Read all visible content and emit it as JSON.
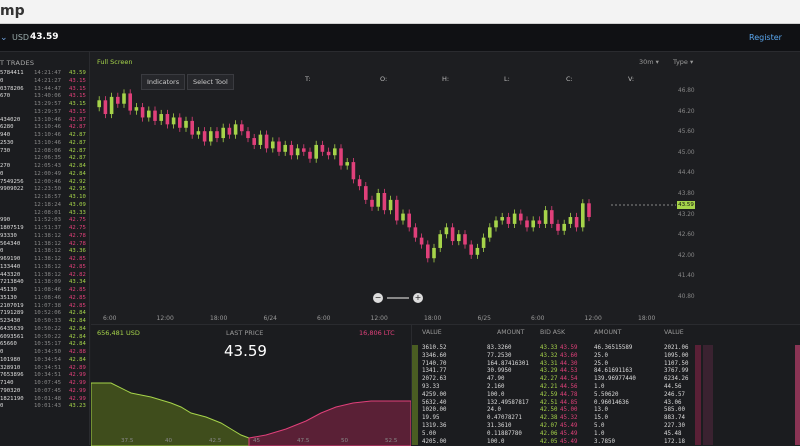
{
  "topbar": {
    "logo": "mp"
  },
  "navbar": {
    "currency": "USD",
    "price": "43.59",
    "register": "Register"
  },
  "trades": {
    "header": "T TRADES",
    "rows": [
      {
        "amount": "5784411",
        "time": "14:21:47",
        "price": "43.59",
        "dir": "up"
      },
      {
        "amount": "0",
        "time": "14:21:27",
        "price": "43.15",
        "dir": "dn"
      },
      {
        "amount": "0378206",
        "time": "13:44:47",
        "price": "43.15",
        "dir": "dn"
      },
      {
        "amount": "670",
        "time": "13:40:06",
        "price": "43.15",
        "dir": "dn"
      },
      {
        "amount": "",
        "time": "13:29:57",
        "price": "43.15",
        "dir": "up"
      },
      {
        "amount": "",
        "time": "13:29:57",
        "price": "43.15",
        "dir": "dn"
      },
      {
        "amount": "434020",
        "time": "13:10:46",
        "price": "42.87",
        "dir": "dn"
      },
      {
        "amount": "6280",
        "time": "13:10:46",
        "price": "42.87",
        "dir": "dn"
      },
      {
        "amount": "940",
        "time": "13:10:46",
        "price": "42.87",
        "dir": "up"
      },
      {
        "amount": "2530",
        "time": "13:10:46",
        "price": "42.87",
        "dir": "up"
      },
      {
        "amount": "730",
        "time": "12:08:06",
        "price": "42.87",
        "dir": "up"
      },
      {
        "amount": "",
        "time": "12:06:35",
        "price": "42.87",
        "dir": "up"
      },
      {
        "amount": "270",
        "time": "12:05:43",
        "price": "42.84",
        "dir": "up"
      },
      {
        "amount": "0",
        "time": "12:00:49",
        "price": "42.84",
        "dir": "up"
      },
      {
        "amount": "7549256",
        "time": "12:00:46",
        "price": "42.92",
        "dir": "up"
      },
      {
        "amount": "9909022",
        "time": "12:23:50",
        "price": "42.95",
        "dir": "up"
      },
      {
        "amount": "",
        "time": "12:18:57",
        "price": "43.10",
        "dir": "up"
      },
      {
        "amount": "",
        "time": "12:18:24",
        "price": "43.09",
        "dir": "up"
      },
      {
        "amount": "",
        "time": "12:08:01",
        "price": "43.33",
        "dir": "up"
      },
      {
        "amount": "990",
        "time": "11:52:03",
        "price": "42.75",
        "dir": "dn"
      },
      {
        "amount": "1807519",
        "time": "11:51:37",
        "price": "42.75",
        "dir": "dn"
      },
      {
        "amount": "93330",
        "time": "11:38:12",
        "price": "42.78",
        "dir": "dn"
      },
      {
        "amount": "564340",
        "time": "11:38:12",
        "price": "42.78",
        "dir": "dn"
      },
      {
        "amount": "0",
        "time": "11:38:12",
        "price": "43.36",
        "dir": "up"
      },
      {
        "amount": "969190",
        "time": "11:38:12",
        "price": "42.85",
        "dir": "dn"
      },
      {
        "amount": "133440",
        "time": "11:38:12",
        "price": "42.85",
        "dir": "dn"
      },
      {
        "amount": "443320",
        "time": "11:38:12",
        "price": "42.82",
        "dir": "dn"
      },
      {
        "amount": "7213840",
        "time": "11:38:09",
        "price": "43.34",
        "dir": "up"
      },
      {
        "amount": "45130",
        "time": "11:08:46",
        "price": "42.85",
        "dir": "dn"
      },
      {
        "amount": "35130",
        "time": "11:08:46",
        "price": "42.85",
        "dir": "dn"
      },
      {
        "amount": "2107019",
        "time": "11:07:38",
        "price": "42.85",
        "dir": "dn"
      },
      {
        "amount": "7191289",
        "time": "10:52:06",
        "price": "42.84",
        "dir": "up"
      },
      {
        "amount": "523430",
        "time": "10:50:33",
        "price": "42.84",
        "dir": "up"
      },
      {
        "amount": "6435639",
        "time": "10:50:22",
        "price": "42.84",
        "dir": "up"
      },
      {
        "amount": "6093561",
        "time": "10:50:22",
        "price": "42.84",
        "dir": "up"
      },
      {
        "amount": "65660",
        "time": "10:35:17",
        "price": "42.84",
        "dir": "up"
      },
      {
        "amount": "0",
        "time": "10:34:50",
        "price": "42.88",
        "dir": "dn"
      },
      {
        "amount": "101980",
        "time": "10:34:54",
        "price": "42.84",
        "dir": "up"
      },
      {
        "amount": "328910",
        "time": "10:34:51",
        "price": "42.89",
        "dir": "dn"
      },
      {
        "amount": "7653896",
        "time": "10:34:51",
        "price": "42.99",
        "dir": "dn"
      },
      {
        "amount": "7140",
        "time": "10:07:45",
        "price": "42.99",
        "dir": "dn"
      },
      {
        "amount": "790320",
        "time": "10:07:45",
        "price": "42.99",
        "dir": "dn"
      },
      {
        "amount": "1821190",
        "time": "10:01:48",
        "price": "42.99",
        "dir": "dn"
      },
      {
        "amount": "0",
        "time": "10:01:43",
        "price": "43.23",
        "dir": "up"
      }
    ]
  },
  "chart": {
    "full_screen": "Full Screen",
    "indicators": "Indicators",
    "select_tool": "Select Tool",
    "ohlc_labels": [
      "T:",
      "O:",
      "H:",
      "L:",
      "C:",
      "V:"
    ],
    "interval": "30m",
    "type_label": "Type",
    "current_price_tag": "43.59",
    "y_ticks": [
      "46.80",
      "46.20",
      "45.60",
      "45.00",
      "44.40",
      "43.80",
      "43.20",
      "42.60",
      "42.00",
      "41.40",
      "40.80"
    ],
    "x_ticks": [
      "6:00",
      "12:00",
      "18:00",
      "6/24",
      "6:00",
      "12:00",
      "18:00",
      "6/25",
      "6:00",
      "12:00",
      "18:00"
    ],
    "zoom_out": "−",
    "zoom_in": "+",
    "up_color": "#a6d44a",
    "down_color": "#e0407a"
  },
  "depth": {
    "buy_total": "656,481 USD",
    "last_price_label": "LAST PRICE",
    "last_price": "43.59",
    "sell_total": "16,806 LTC",
    "x_ticks": [
      "37.5",
      "40",
      "42.5",
      "45",
      "47.5",
      "50",
      "52.5"
    ]
  },
  "book": {
    "headers": [
      "VALUE",
      "AMOUNT",
      "BID ASK",
      "AMOUNT",
      "VALUE"
    ],
    "bid_value": [
      "3610.52",
      "3346.60",
      "7140.70",
      "1341.77",
      "2072.63",
      "93.33",
      "4259.00",
      "5632.40",
      "1020.00",
      "19.95",
      "1319.36",
      "5.00",
      "4205.00"
    ],
    "bid_amount": [
      "83.3260",
      "77.2530",
      "164.87416301",
      "30.9950",
      "47.90",
      "2.160",
      "100.0",
      "132.49587817",
      "24.0",
      "0.47078271",
      "31.3610",
      "0.11887780",
      "100.0"
    ],
    "bid_price": [
      "43.33",
      "43.32",
      "43.31",
      "43.29",
      "42.27",
      "42.21",
      "42.59",
      "42.51",
      "42.50",
      "42.38",
      "42.07",
      "42.06",
      "42.05"
    ],
    "ask_price": [
      "43.59",
      "43.60",
      "44.30",
      "44.53",
      "44.54",
      "44.56",
      "44.78",
      "44.85",
      "45.00",
      "45.32",
      "45.49",
      "45.49",
      "45.49"
    ],
    "ask_amount": [
      "46.36515589",
      "25.0",
      "25.0",
      "84.61691163",
      "139.96977440",
      "1.0",
      "5.50620",
      "0.96014636",
      "13.0",
      "15.0",
      "5.0",
      "1.0",
      "3.7850"
    ],
    "ask_value": [
      "2021.06",
      "1095.00",
      "1107.50",
      "3767.99",
      "6234.26",
      "44.56",
      "246.57",
      "43.06",
      "585.00",
      "883.74",
      "227.30",
      "45.48",
      "172.18"
    ]
  }
}
